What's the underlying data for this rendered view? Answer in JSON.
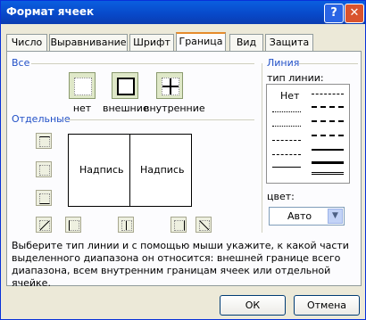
{
  "window": {
    "title": "Формат ячеек",
    "help_glyph": "?",
    "close_glyph": "✕"
  },
  "tabs": [
    {
      "label": "Число"
    },
    {
      "label": "Выравнивание"
    },
    {
      "label": "Шрифт"
    },
    {
      "label": "Граница"
    },
    {
      "label": "Вид"
    },
    {
      "label": "Защита"
    }
  ],
  "active_tab": "Граница",
  "all_group": {
    "title": "Все",
    "presets": [
      {
        "label": "нет"
      },
      {
        "label": "внешние"
      },
      {
        "label": "внутренние"
      }
    ]
  },
  "individual_group": {
    "title": "Отдельные"
  },
  "preview": {
    "cell_left": "Надпись",
    "cell_right": "Надпись"
  },
  "line_group": {
    "title": "Линия",
    "type_label": "тип линии:",
    "none_label": "Нет",
    "color_label": "цвет:",
    "color_value": "Авто"
  },
  "description": "Выберите тип линии и с помощью мыши укажите, к какой части выделенного диапазона он относится: внешней границе всего диапазона, всем внутренним границам ячеек или отдельной ячейке.",
  "buttons": {
    "ok": "ОК",
    "cancel": "Отмена"
  },
  "colors": {
    "title_bar": "#0848c8",
    "group_title": "#2150c7",
    "tab_highlight": "#e68b2c"
  }
}
